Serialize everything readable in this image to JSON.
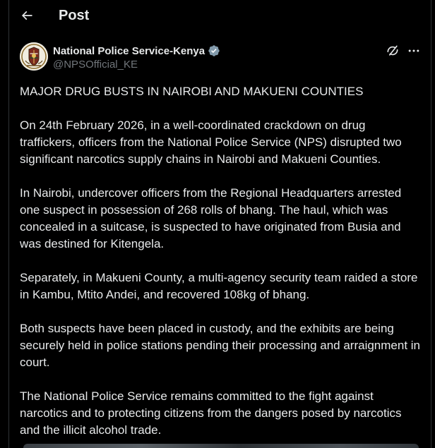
{
  "header": {
    "title": "Post"
  },
  "post": {
    "author": {
      "display_name": "National Police Service-Kenya",
      "handle": "@NPSOfficial_KE",
      "verified": true
    },
    "paragraphs": [
      "MAJOR DRUG BUSTS IN NAIROBI AND MAKUENI COUNTIES",
      "On 24th February 2026, in a well-coordinated crackdown on drug traffickers, officers from the National Police Service (NPS) disrupted two significant narcotics supply chains in Nairobi and Makueni Counties.",
      "In Nairobi, undercover officers from the Regional Headquarters arrested one suspect in possession of 268 rolls of bhang. The haul, which was concealed in a suitcase, is suspected to have originated from Busia and was destined for Kitengela.",
      "Separately, in Makueni County, a multi-agency security team raided a store in Kambu, Mtito Andei, and recovered 108kg of bhang.",
      "Both suspects have been placed in custody, and the exhibits are being securely held in police stations pending their processing and arraignment in court.",
      "The National Police Service remains committed to the fight against narcotics and to protecting citizens from the dangers posed by narcotics and the illicit alcohol trade."
    ]
  },
  "icons": {
    "back": "arrow-left-icon",
    "verified": "verified-badge-icon",
    "grok": "grok-icon",
    "more": "more-horizontal-icon"
  },
  "colors": {
    "background": "#000000",
    "text_primary": "#e7e9ea",
    "text_secondary": "#71767b",
    "verified_badge": "#829aab",
    "border": "#2f3336"
  }
}
